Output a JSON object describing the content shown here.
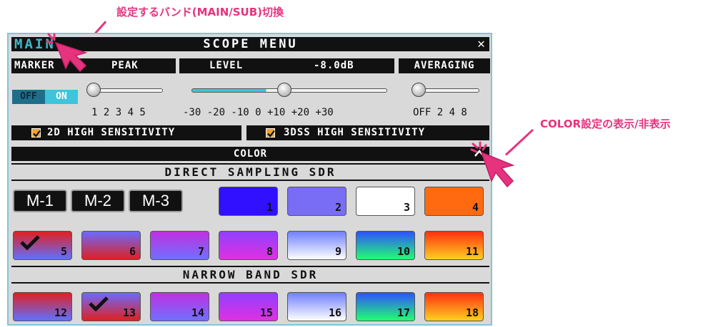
{
  "annotations": {
    "band_callout": "設定するバンド(MAIN/SUB)切換",
    "color_callout": "COLOR設定の表示/非表示"
  },
  "title_bar": {
    "band": "MAIN",
    "title": "SCOPE MENU",
    "close": "✕"
  },
  "marker": {
    "label": "MARKER",
    "value": "PEAK",
    "ticks": "1 2 3 4 5",
    "level": 0.0
  },
  "level": {
    "label": "LEVEL",
    "value": "-8.0dB",
    "ticks": "-30 -20 -10  0 +10 +20 +30",
    "level": 0.46
  },
  "averaging": {
    "label": "AVERAGING",
    "ticks": "OFF 2 4 8",
    "level": 0.0
  },
  "toggle": {
    "off": "OFF",
    "on": "ON"
  },
  "checks": [
    {
      "label": "2D HIGH SENSITIVITY",
      "checked": true
    },
    {
      "label": "3DSS HIGH SENSITIVITY",
      "checked": true
    }
  ],
  "color_section": {
    "title": "COLOR"
  },
  "direct_sampling": {
    "title": "DIRECT SAMPLING SDR"
  },
  "narrow_band": {
    "title": "NARROW BAND SDR"
  },
  "memory_buttons": [
    "M-1",
    "M-2",
    "M-3"
  ],
  "swatches": {
    "row1": [
      {
        "num": "1",
        "selected": false,
        "colors": [
          "#3010ff",
          "#3010ff"
        ]
      },
      {
        "num": "2",
        "selected": false,
        "colors": [
          "#7a6df5",
          "#7a6df5"
        ]
      },
      {
        "num": "3",
        "selected": false,
        "colors": [
          "#ffffff",
          "#ffffff"
        ]
      },
      {
        "num": "4",
        "selected": false,
        "colors": [
          "#ff6a10",
          "#ff6a10"
        ]
      }
    ],
    "row2": [
      {
        "num": "5",
        "selected": true,
        "colors": [
          "#e02020",
          "#6070ff"
        ]
      },
      {
        "num": "6",
        "selected": false,
        "colors": [
          "#6a6aff",
          "#e02020"
        ]
      },
      {
        "num": "7",
        "selected": false,
        "colors": [
          "#c030e0",
          "#7070ff"
        ]
      },
      {
        "num": "8",
        "selected": false,
        "colors": [
          "#9040ff",
          "#e030e0"
        ]
      },
      {
        "num": "9",
        "selected": false,
        "colors": [
          "#7080ff",
          "#ffffff"
        ]
      },
      {
        "num": "10",
        "selected": false,
        "colors": [
          "#3050ff",
          "#20ff70"
        ]
      },
      {
        "num": "11",
        "selected": false,
        "colors": [
          "#ff3010",
          "#ffd020"
        ]
      }
    ],
    "row3": [
      {
        "num": "12",
        "selected": false,
        "colors": [
          "#e02020",
          "#6070ff"
        ]
      },
      {
        "num": "13",
        "selected": true,
        "colors": [
          "#6a6aff",
          "#e02020"
        ]
      },
      {
        "num": "14",
        "selected": false,
        "colors": [
          "#c030e0",
          "#7070ff"
        ]
      },
      {
        "num": "15",
        "selected": false,
        "colors": [
          "#9040ff",
          "#e030e0"
        ]
      },
      {
        "num": "16",
        "selected": false,
        "colors": [
          "#7080ff",
          "#ffffff"
        ]
      },
      {
        "num": "17",
        "selected": false,
        "colors": [
          "#3050ff",
          "#20ff70"
        ]
      },
      {
        "num": "18",
        "selected": false,
        "colors": [
          "#ff3010",
          "#ffd020"
        ]
      }
    ]
  },
  "colors": {
    "accent": "#3ec4dd",
    "annotation": "#e6337e",
    "panel_border": "#7fc6de"
  }
}
